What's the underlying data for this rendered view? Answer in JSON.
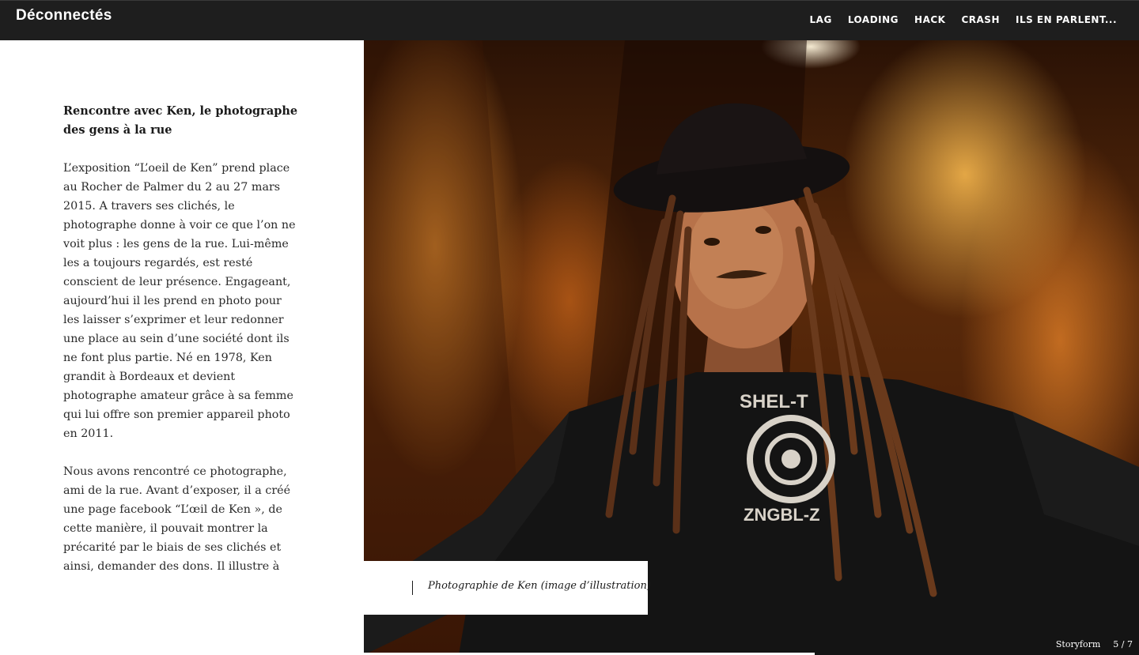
{
  "header": {
    "site_title": "Déconnectés",
    "nav": [
      "LAG",
      "LOADING",
      "HACK",
      "CRASH",
      "ILS EN PARLENT..."
    ]
  },
  "article": {
    "title": "Rencontre avec Ken, le photographe des gens à la rue",
    "paragraphs": [
      "L’exposition “L’oeil de Ken” prend place au Rocher de Palmer du 2 au 27 mars 2015. A travers ses clichés, le photographe donne à voir ce que l’on ne voit plus : les gens de la rue. Lui-même les a toujours regardés, est resté conscient de leur présence. Engageant, aujourd’hui il les prend en photo pour les laisser s’exprimer et leur redonner une place au sein d’une société dont ils ne font plus partie. Né en 1978, Ken grandit à Bordeaux et devient photographe amateur grâce à sa femme qui lui offre son premier appareil photo en 2011.",
      "Nous avons rencontré ce photographe, ami de la rue. Avant d’exposer, il a créé une page facebook “L’œil de Ken », de cette manière, il pouvait montrer la précarité par le biais de ses clichés et ainsi, demander des dons. Il illustre à chaque fois ses posts par une photo, pour toucher les gens car « dans notre société, tout passe par l’image : il faut voir"
    ]
  },
  "photo": {
    "caption": "Photographie de Ken (image d’illustration)",
    "shirt_text_top": "SHEL-T",
    "shirt_text_bottom": "ZNGBL-Z"
  },
  "footer": {
    "brand": "Storyform",
    "pagination": "5 / 7"
  },
  "colors": {
    "topbar": "#1e1e1e",
    "background": "#ffffff",
    "text": "#2a2a2a",
    "photo_warm": "#e08a2a"
  }
}
